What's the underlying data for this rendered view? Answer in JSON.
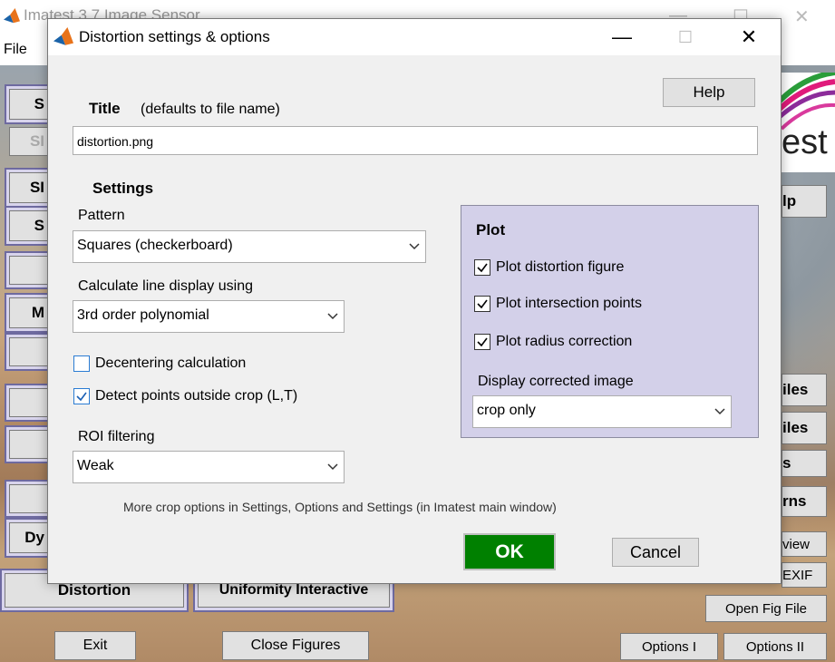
{
  "main_window": {
    "title": "Imatest 3.7  Image Sensor",
    "menu_file": "File",
    "logo_text": "est",
    "left_buttons": [
      "S",
      "SI",
      "SI",
      "S",
      "M",
      "Dy"
    ],
    "distortion_button": "Distortion",
    "uniformity_button": "Uniformity Interactive",
    "right_buttons": [
      "lp",
      "iles",
      "iles",
      "s",
      "rns",
      "view",
      "EXIF"
    ],
    "open_fig_button": "Open Fig File",
    "exit_button": "Exit",
    "close_figures_button": "Close Figures",
    "options1_button": "Options I",
    "options2_button": "Options II"
  },
  "dialog": {
    "title": "Distortion settings & options",
    "help_button": "Help",
    "title_label": "Title",
    "title_hint": "(defaults to file name)",
    "title_value": "distortion.png",
    "settings_heading": "Settings",
    "pattern_label": "Pattern",
    "pattern_value": "Squares (checkerboard)",
    "calc_label": "Calculate line display using",
    "calc_value": "3rd order polynomial",
    "decentering_label": "Decentering calculation",
    "decentering_checked": false,
    "detect_label": "Detect points outside crop (L,T)",
    "detect_checked": true,
    "roi_label": "ROI filtering",
    "roi_value": "Weak",
    "plot_heading": "Plot",
    "plot_distortion_label": "Plot distortion figure",
    "plot_intersection_label": "Plot intersection points",
    "plot_radius_label": "Plot radius correction",
    "display_corrected_label": "Display corrected image",
    "display_corrected_value": "crop only",
    "footer_note": "More crop options in Settings, Options and Settings (in Imatest main window)",
    "ok_button": "OK",
    "cancel_button": "Cancel"
  },
  "colors": {
    "ok_green": "#008000",
    "plot_panel_bg": "#d3d0e9",
    "checkbox_blue": "#2b7cd3"
  }
}
